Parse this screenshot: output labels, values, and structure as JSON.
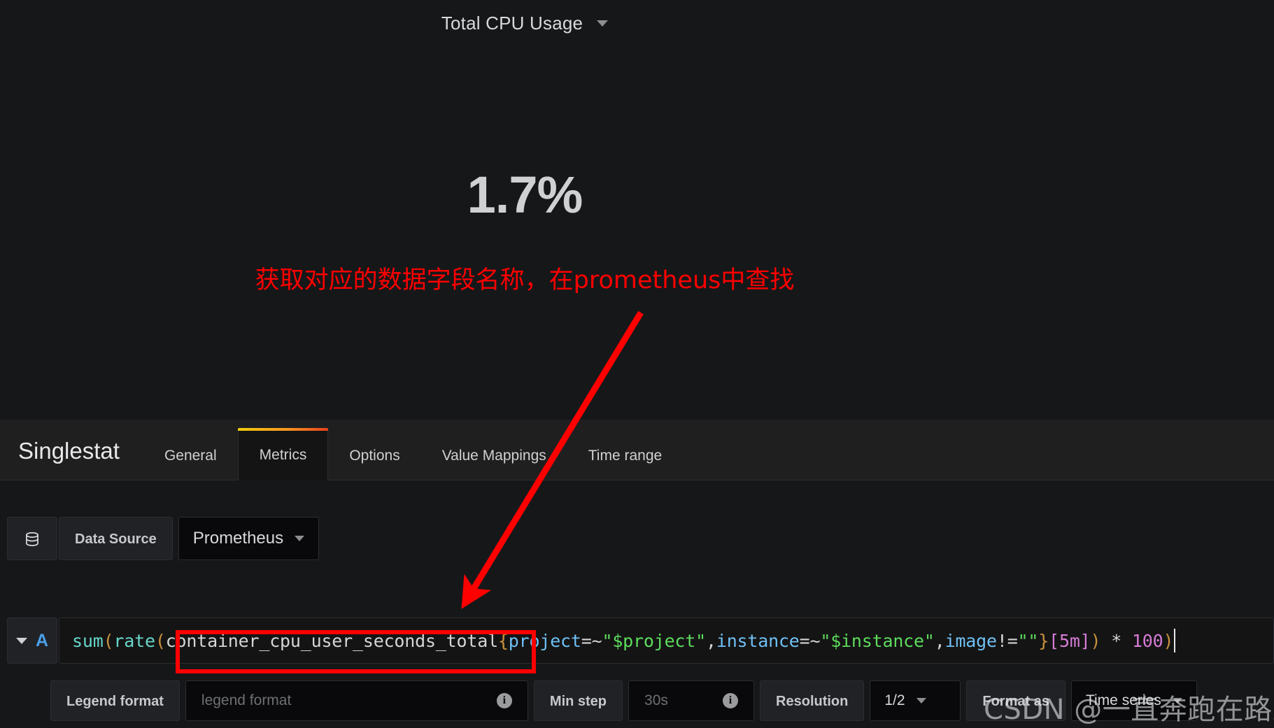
{
  "panel": {
    "title": "Total CPU Usage",
    "title_caret_icon": "chevron-down-icon",
    "stat_value": "1.7%"
  },
  "annotation": {
    "note_text": "获取对应的数据字段名称，在prometheus中查找",
    "note_color": "#fe0000",
    "arrow_color": "#fe0000",
    "highlight_box_color": "#fe0000"
  },
  "editor": {
    "panel_type": "Singlestat",
    "tabs": [
      {
        "label": "General",
        "active": false
      },
      {
        "label": "Metrics",
        "active": true
      },
      {
        "label": "Options",
        "active": false
      },
      {
        "label": "Value Mappings",
        "active": false
      },
      {
        "label": "Time range",
        "active": false
      }
    ],
    "active_tab_accent": "#f2cc0c"
  },
  "metrics": {
    "datasource": {
      "icon": "database-icon",
      "label": "Data Source",
      "selected": "Prometheus",
      "caret_icon": "chevron-down-icon"
    },
    "query": {
      "letter": "A",
      "toggle_icon": "chevron-down-icon",
      "expression_tokens": [
        {
          "t": "sum",
          "c": "tok-fn"
        },
        {
          "t": "(",
          "c": "tok-paren"
        },
        {
          "t": "rate",
          "c": "tok-fn"
        },
        {
          "t": "(",
          "c": "tok-paren"
        },
        {
          "t": "container_cpu_user_seconds_total",
          "c": "tok-metric"
        },
        {
          "t": "{",
          "c": "tok-brace"
        },
        {
          "t": "project",
          "c": "tok-label"
        },
        {
          "t": "=~",
          "c": "tok-op"
        },
        {
          "t": "\"$project\"",
          "c": "tok-string"
        },
        {
          "t": ",",
          "c": "tok-comma"
        },
        {
          "t": "instance",
          "c": "tok-label"
        },
        {
          "t": "=~",
          "c": "tok-op"
        },
        {
          "t": "\"$instance\"",
          "c": "tok-string"
        },
        {
          "t": ",",
          "c": "tok-comma"
        },
        {
          "t": "image",
          "c": "tok-label"
        },
        {
          "t": "!=",
          "c": "tok-op"
        },
        {
          "t": "\"\"",
          "c": "tok-string"
        },
        {
          "t": "}",
          "c": "tok-brace"
        },
        {
          "t": "[5m]",
          "c": "tok-range"
        },
        {
          "t": ")",
          "c": "tok-paren"
        },
        {
          "t": " * ",
          "c": "tok-op"
        },
        {
          "t": "100",
          "c": "tok-num"
        },
        {
          "t": ")",
          "c": "tok-paren"
        }
      ],
      "expression_plain": "sum(rate(container_cpu_user_seconds_total{project=~\"$project\",instance=~\"$instance\",image!=\"\"}[5m]) * 100)",
      "highlighted_metric": "container_cpu_user_seconds_total"
    },
    "options": {
      "legend_format_label": "Legend format",
      "legend_format_placeholder": "legend format",
      "legend_format_value": "",
      "legend_info_icon": "info-icon",
      "min_step_label": "Min step",
      "min_step_placeholder": "30s",
      "min_step_value": "",
      "min_step_info_icon": "info-icon",
      "resolution_label": "Resolution",
      "resolution_value": "1/2",
      "resolution_caret_icon": "chevron-down-icon",
      "format_as_label": "Format as",
      "format_as_value": "Time series",
      "format_as_caret_icon": "chevron-down-icon"
    }
  },
  "watermark": {
    "text": "CSDN @一直奔跑在路上"
  }
}
